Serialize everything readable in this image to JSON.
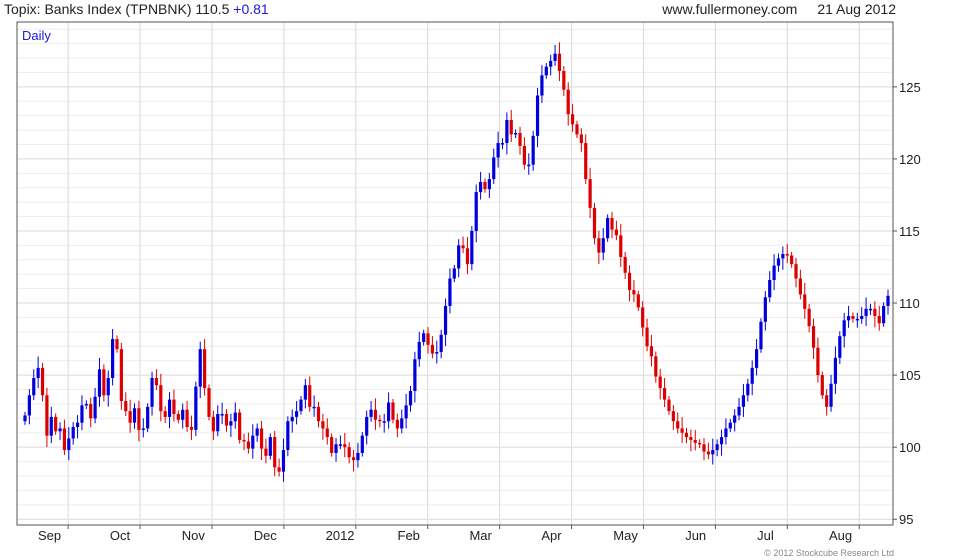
{
  "header": {
    "instrument": "Topix: Banks Index (TPNBNK)",
    "last": "110.5",
    "change": "+0.81",
    "site": "www.fullermoney.com",
    "date": "21 Aug 2012"
  },
  "footer": {
    "copyright": "© 2012 Stockcube Research Ltd"
  },
  "colors": {
    "up": "#0000dd",
    "down": "#dd0000",
    "grid": "#d9d9d9",
    "frame": "#555555",
    "label": "#1a1adb"
  },
  "chart_data": {
    "type": "candlestick",
    "period_label": "Daily",
    "x_tick_labels": [
      "Sep",
      "Oct",
      "Nov",
      "Dec",
      "2012",
      "Feb",
      "Mar",
      "Apr",
      "May",
      "Jun",
      "Jul",
      "Aug"
    ],
    "y_ticks": [
      95,
      100,
      105,
      110,
      115,
      120,
      125
    ],
    "ylim": [
      94.6,
      129.5
    ],
    "grid": true,
    "closes": [
      102.2,
      103.6,
      104.8,
      105.5,
      103.6,
      100.8,
      102.1,
      101.1,
      101.3,
      99.8,
      100.6,
      101.4,
      101.7,
      102.9,
      103.0,
      102.0,
      103.5,
      105.4,
      103.6,
      104.8,
      107.5,
      106.8,
      103.2,
      102.5,
      101.7,
      102.7,
      101.2,
      101.3,
      102.8,
      104.8,
      104.3,
      102.5,
      102.1,
      103.3,
      102.3,
      101.9,
      102.6,
      101.4,
      101.2,
      104.2,
      106.8,
      104.1,
      102.1,
      101.1,
      102.3,
      102.3,
      101.5,
      101.8,
      102.4,
      100.5,
      100.4,
      99.9,
      100.8,
      101.3,
      99.9,
      99.4,
      100.7,
      98.6,
      98.3,
      99.8,
      101.8,
      102.1,
      102.5,
      103.3,
      104.3,
      102.8,
      102.8,
      101.8,
      101.3,
      100.7,
      99.6,
      100.2,
      100.2,
      100.0,
      99.3,
      99.1,
      99.6,
      100.8,
      102.1,
      102.6,
      101.9,
      101.8,
      101.8,
      103.1,
      101.9,
      101.3,
      102.0,
      102.9,
      103.9,
      106.1,
      107.3,
      107.9,
      107.1,
      106.5,
      106.6,
      107.8,
      109.8,
      111.7,
      112.4,
      114.0,
      113.8,
      112.7,
      115.0,
      117.7,
      118.4,
      117.9,
      118.6,
      120.1,
      121.1,
      121.1,
      122.7,
      121.7,
      121.8,
      120.9,
      119.6,
      119.6,
      121.6,
      124.4,
      125.8,
      126.4,
      126.8,
      127.3,
      126.1,
      124.8,
      123.1,
      122.4,
      121.7,
      121.1,
      118.6,
      116.6,
      114.5,
      113.5,
      114.5,
      115.9,
      115.1,
      114.7,
      113.2,
      112.1,
      110.9,
      110.6,
      109.7,
      108.3,
      107.0,
      106.3,
      104.9,
      104.1,
      103.3,
      102.5,
      101.8,
      101.3,
      101.0,
      100.7,
      100.5,
      100.3,
      100.2,
      99.7,
      99.5,
      99.8,
      100.2,
      100.7,
      101.3,
      101.7,
      102.2,
      102.8,
      103.6,
      104.4,
      105.5,
      106.8,
      108.7,
      110.4,
      111.6,
      112.6,
      113.1,
      113.4,
      113.3,
      112.7,
      111.7,
      110.6,
      109.6,
      108.4,
      106.9,
      105.0,
      103.6,
      102.8,
      104.4,
      106.2,
      107.7,
      108.8,
      109.1,
      108.9,
      108.9,
      109.1,
      109.6,
      109.6,
      109.1,
      108.6,
      109.8,
      110.5
    ]
  }
}
